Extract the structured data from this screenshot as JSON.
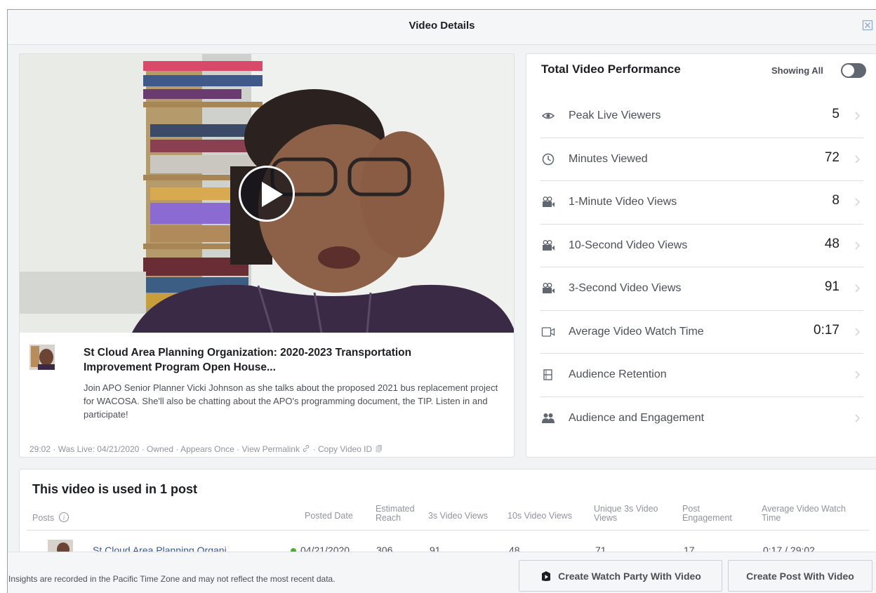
{
  "modal": {
    "title": "Video Details"
  },
  "video": {
    "title": "St Cloud Area Planning Organization: 2020-2023 Transportation Improvement Program Open House...",
    "description": "Join APO Senior Planner Vicki Johnson as she talks about the proposed 2021 bus replacement project for WACOSA. She'll also be chatting about the APO's programming document, the TIP. Listen in and participate!",
    "meta": {
      "duration": "29:02",
      "was_live": "Was Live: 04/21/2020",
      "owned": "Owned",
      "appears": "Appears Once",
      "permalink": "View Permalink",
      "copy_id": "Copy Video ID"
    }
  },
  "performance": {
    "title": "Total Video Performance",
    "showing_label": "Showing All",
    "metrics": [
      {
        "label": "Peak Live Viewers",
        "value": "5",
        "icon": "eye-icon"
      },
      {
        "label": "Minutes Viewed",
        "value": "72",
        "icon": "clock-icon"
      },
      {
        "label": "1-Minute Video Views",
        "value": "8",
        "icon": "video-camera-icon"
      },
      {
        "label": "10-Second Video Views",
        "value": "48",
        "icon": "video-camera-icon"
      },
      {
        "label": "3-Second Video Views",
        "value": "91",
        "icon": "video-camera-icon"
      },
      {
        "label": "Average Video Watch Time",
        "value": "0:17",
        "icon": "video-icon"
      },
      {
        "label": "Audience Retention",
        "value": "",
        "icon": "film-icon"
      },
      {
        "label": "Audience and Engagement",
        "value": "",
        "icon": "people-icon"
      }
    ]
  },
  "posts": {
    "title": "This video is used in 1 post",
    "headers": {
      "posts": "Posts",
      "posted_date": "Posted Date",
      "reach": "Estimated Reach",
      "views3s": "3s Video Views",
      "views10s": "10s Video Views",
      "unique3s": "Unique 3s Video Views",
      "engagement": "Post Engagement",
      "avg_watch": "Average Video Watch Time"
    },
    "row": {
      "name": "St Cloud Area Planning Organi",
      "posted_date": "04/21/2020",
      "reach": "306",
      "views3s": "91",
      "views10s": "48",
      "unique3s": "71",
      "engagement": "17",
      "avg_watch": "0:17 / 29:02"
    }
  },
  "footer": {
    "note": "Insights are recorded in the Pacific Time Zone and may not reflect the most recent data.",
    "watch_party_label": "Create Watch Party With Video",
    "create_post_label": "Create Post With Video"
  },
  "colors": {
    "link": "#365899",
    "status_green": "#42b72a"
  }
}
